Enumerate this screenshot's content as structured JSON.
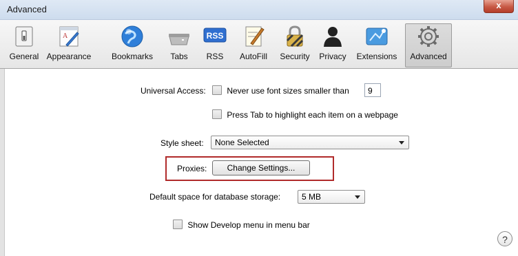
{
  "window": {
    "title": "Advanced",
    "close_label": "x"
  },
  "toolbar": {
    "items": [
      {
        "label": "General",
        "icon": "general-icon"
      },
      {
        "label": "Appearance",
        "icon": "appearance-icon"
      },
      {
        "label": "Bookmarks",
        "icon": "bookmarks-icon"
      },
      {
        "label": "Tabs",
        "icon": "tabs-icon"
      },
      {
        "label": "RSS",
        "icon": "rss-icon",
        "badge": "RSS"
      },
      {
        "label": "AutoFill",
        "icon": "autofill-icon"
      },
      {
        "label": "Security",
        "icon": "security-icon"
      },
      {
        "label": "Privacy",
        "icon": "privacy-icon"
      },
      {
        "label": "Extensions",
        "icon": "extensions-icon"
      },
      {
        "label": "Advanced",
        "icon": "advanced-icon",
        "active": true
      }
    ]
  },
  "settings": {
    "universal_access_label": "Universal Access:",
    "never_font_label": "Never use font sizes smaller than",
    "font_size_value": "9",
    "press_tab_label": "Press Tab to highlight each item on a webpage",
    "style_sheet_label": "Style sheet:",
    "style_sheet_value": "None Selected",
    "proxies_label": "Proxies:",
    "change_settings_label": "Change Settings...",
    "db_storage_label": "Default space for database storage:",
    "db_storage_value": "5 MB",
    "show_develop_label": "Show Develop menu in menu bar"
  },
  "help": {
    "label": "?"
  },
  "colors": {
    "highlight_box": "#b02a2a",
    "title_bar": "#d6e3f2",
    "close_button": "#c75a45"
  }
}
